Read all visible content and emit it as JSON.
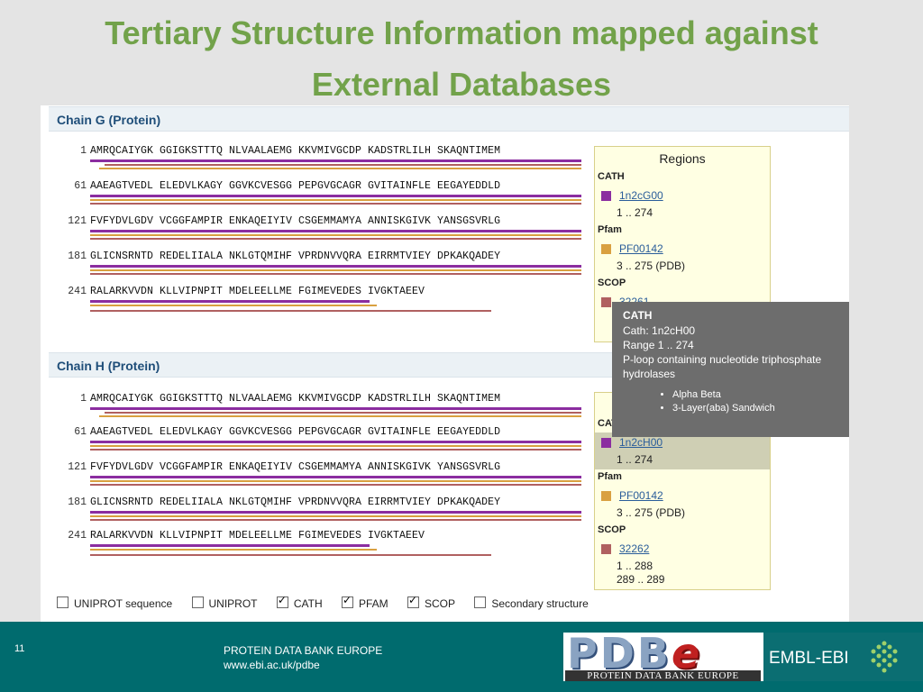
{
  "slide": {
    "title_line1": "Tertiary Structure Information mapped against",
    "title_line2": "External Databases",
    "page_number": "11",
    "footer_org": "PROTEIN DATA BANK EUROPE",
    "footer_url": "www.ebi.ac.uk/pdbe",
    "logo_pdbe_big": "PDB",
    "logo_pdbe_e": "e",
    "logo_pdbe_small": "PROTEIN DATA BANK EUROPE",
    "logo_embl": "EMBL-EBI"
  },
  "chainG": {
    "header": "Chain G (Protein)",
    "rows": [
      {
        "num": "1",
        "seq": "AMRQCAIYGK GGIGKSTTTQ NLVAALAEMG KKVMIVGCDP KADSTRLILH SKAQNTIMEM"
      },
      {
        "num": "61",
        "seq": "AAEAGTVEDL ELEDVLKAGY GGVKCVESGG PEPGVGCAGR GVITAINFLE EEGAYEDDLD"
      },
      {
        "num": "121",
        "seq": "FVFYDVLGDV VCGGFAMPIR ENKAQEIYIV CSGEMMAMYA ANNISKGIVK YANSGSVRLG"
      },
      {
        "num": "181",
        "seq": "GLICNSRNTD REDELIIALA NKLGTQMIHF VPRDNVVQRA EIRRMTVIEY DPKAKQADEY"
      },
      {
        "num": "241",
        "seq": "RALARKVVDN KLLVIPNPIT MDELEELLME FGIMEVEDES IVGKTAEEV"
      }
    ]
  },
  "chainH": {
    "header": "Chain H (Protein)",
    "rows": [
      {
        "num": "1",
        "seq": "AMRQCAIYGK GGIGKSTTTQ NLVAALAEMG KKVMIVGCDP KADSTRLILH SKAQNTIMEM"
      },
      {
        "num": "61",
        "seq": "AAEAGTVEDL ELEDVLKAGY GGVKCVESGG PEPGVGCAGR GVITAINFLE EEGAYEDDLD"
      },
      {
        "num": "121",
        "seq": "FVFYDVLGDV VCGGFAMPIR ENKAQEIYIV CSGEMMAMYA ANNISKGIVK YANSGSVRLG"
      },
      {
        "num": "181",
        "seq": "GLICNSRNTD REDELIIALA NKLGTQMIHF VPRDNVVQRA EIRRMTVIEY DPKAKQADEY"
      },
      {
        "num": "241",
        "seq": "RALARKVVDN KLLVIPNPIT MDELEELLME FGIMEVEDES IVGKTAEEV"
      }
    ]
  },
  "regionsG": {
    "title": "Regions",
    "cath_label": "CATH",
    "cath_id": "1n2cG00",
    "cath_range": "1 .. 274",
    "pfam_label": "Pfam",
    "pfam_id": "PF00142",
    "pfam_range": "3 .. 275 (PDB)",
    "scop_label": "SCOP",
    "scop_id": "32261"
  },
  "regionsH": {
    "cath_label": "CATH",
    "cath_id": "1n2cH00",
    "cath_range": "1 .. 274",
    "pfam_label": "Pfam",
    "pfam_id": "PF00142",
    "pfam_range": "3 .. 275 (PDB)",
    "scop_label": "SCOP",
    "scop_id": "32262",
    "scop_range1": "1 .. 288",
    "scop_range2": "289 .. 289"
  },
  "tooltip": {
    "title": "CATH",
    "line1": "Cath: 1n2cH00",
    "line2": "Range 1 .. 274",
    "line3": "P-loop containing nucleotide triphosphate",
    "line4": "hydrolases",
    "bullet1": "Alpha Beta",
    "bullet2": "3-Layer(aba) Sandwich"
  },
  "checkboxes": [
    {
      "label": "UNIPROT sequence",
      "checked": false
    },
    {
      "label": "UNIPROT",
      "checked": false
    },
    {
      "label": "CATH",
      "checked": true
    },
    {
      "label": "PFAM",
      "checked": true
    },
    {
      "label": "SCOP",
      "checked": true
    },
    {
      "label": "Secondary structure",
      "checked": false
    }
  ],
  "colors": {
    "title": "#72a24a",
    "cath": "#8b2da0",
    "pfam": "#d9a040",
    "scop": "#b06060",
    "footer": "#006b6e"
  }
}
